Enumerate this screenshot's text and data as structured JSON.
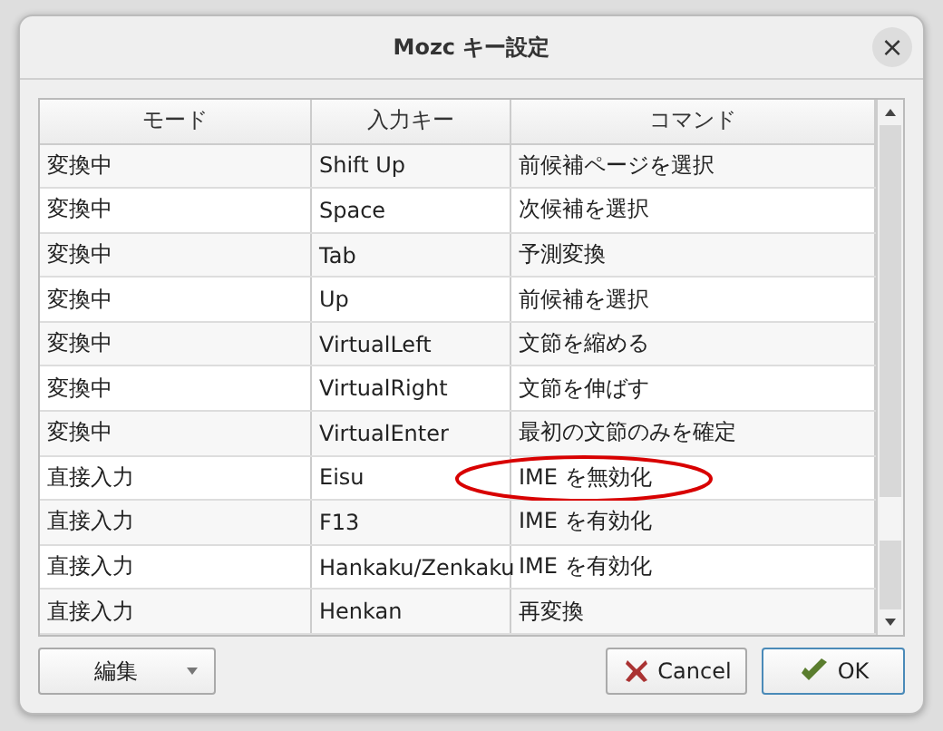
{
  "window": {
    "title": "Mozc キー設定",
    "close": "×"
  },
  "table": {
    "columns": [
      "モード",
      "入力キー",
      "コマンド"
    ],
    "rows": [
      {
        "mode": "変換中",
        "key": "Shift Up",
        "command": "前候補ページを選択",
        "circled": false
      },
      {
        "mode": "変換中",
        "key": "Space",
        "command": "次候補を選択",
        "circled": false
      },
      {
        "mode": "変換中",
        "key": "Tab",
        "command": "予測変換",
        "circled": false
      },
      {
        "mode": "変換中",
        "key": "Up",
        "command": "前候補を選択",
        "circled": false
      },
      {
        "mode": "変換中",
        "key": "VirtualLeft",
        "command": "文節を縮める",
        "circled": false
      },
      {
        "mode": "変換中",
        "key": "VirtualRight",
        "command": "文節を伸ばす",
        "circled": false
      },
      {
        "mode": "変換中",
        "key": "VirtualEnter",
        "command": "最初の文節のみを確定",
        "circled": false
      },
      {
        "mode": "直接入力",
        "key": "Eisu",
        "command": "IME を無効化",
        "circled": true
      },
      {
        "mode": "直接入力",
        "key": "F13",
        "command": "IME を有効化",
        "circled": false
      },
      {
        "mode": "直接入力",
        "key": "Hankaku/Zenkaku",
        "command": "IME を有効化",
        "circled": false
      },
      {
        "mode": "直接入力",
        "key": "Henkan",
        "command": "再変換",
        "circled": false
      }
    ]
  },
  "buttons": {
    "edit": "編集",
    "cancel": "Cancel",
    "ok": "OK"
  }
}
